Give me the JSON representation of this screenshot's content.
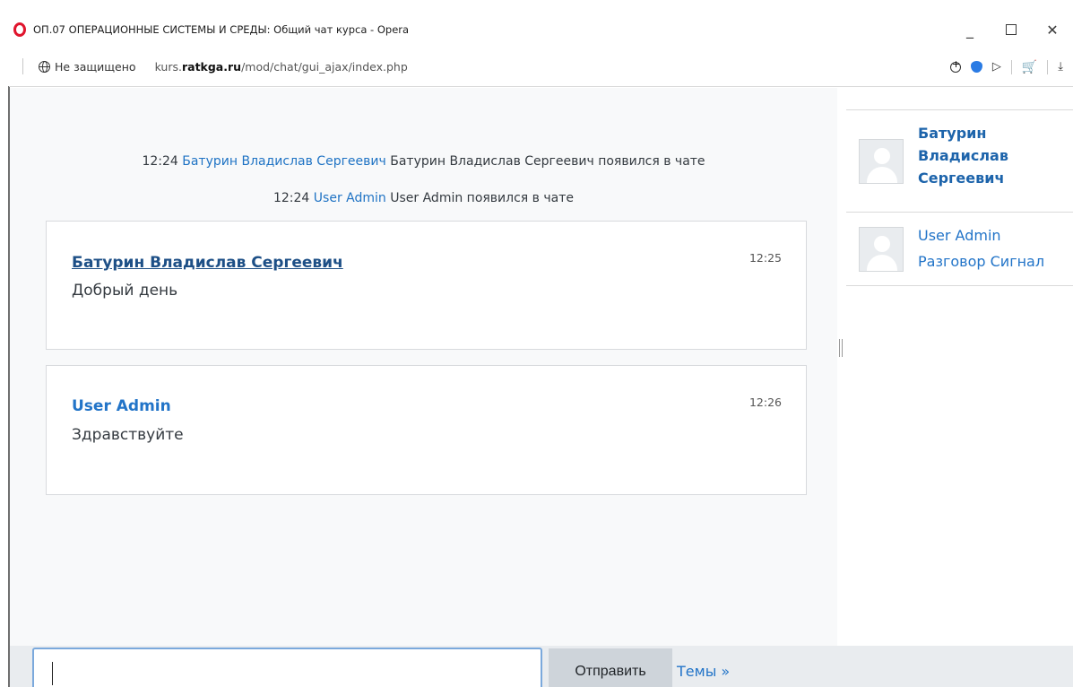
{
  "window": {
    "title": "ОП.07 ОПЕРАЦИОННЫЕ СИСТЕМЫ И СРЕДЫ: Общий чат курса - Opera",
    "minimize_glyph": "_",
    "close_glyph": "✕"
  },
  "address_bar": {
    "security_label": "Не защищено",
    "url_prefix": "kurs.",
    "url_domain": "ratkga.ru",
    "url_path": "/mod/chat/gui_ajax/index.php"
  },
  "chat": {
    "system_messages": [
      {
        "time": "12:24",
        "user": "Батурин Владислав Сергеевич",
        "text": "Батурин Владислав Сергеевич появился в чате"
      },
      {
        "time": "12:24",
        "user": "User Admin",
        "text": "User Admin появился в чате"
      }
    ],
    "messages": [
      {
        "author": "Батурин Владислав Сергеевич",
        "time": "12:25",
        "text": "Добрый день"
      },
      {
        "author": "User Admin",
        "time": "12:26",
        "text": "Здравствуйте"
      }
    ]
  },
  "users": [
    {
      "name": "Батурин Владислав Сергеевич",
      "actions": ""
    },
    {
      "name": "User Admin",
      "actions": "Разговор Сигнал"
    }
  ],
  "composer": {
    "input_value": "",
    "send_label": "Отправить",
    "themes_label": "Темы »"
  },
  "icons": {
    "browser_logo": "opera-logo",
    "security": "globe-icon",
    "zoom": "zoom-icon",
    "vpn": "vpn-icon",
    "send": "send-icon",
    "cart": "cart-icon",
    "download": "download-icon",
    "avatar": "user-avatar-icon"
  },
  "colors": {
    "link": "#2274c8",
    "author_primary": "#1d4f86",
    "opera_red": "#e0152d",
    "chat_background": "#f8f9fa"
  }
}
